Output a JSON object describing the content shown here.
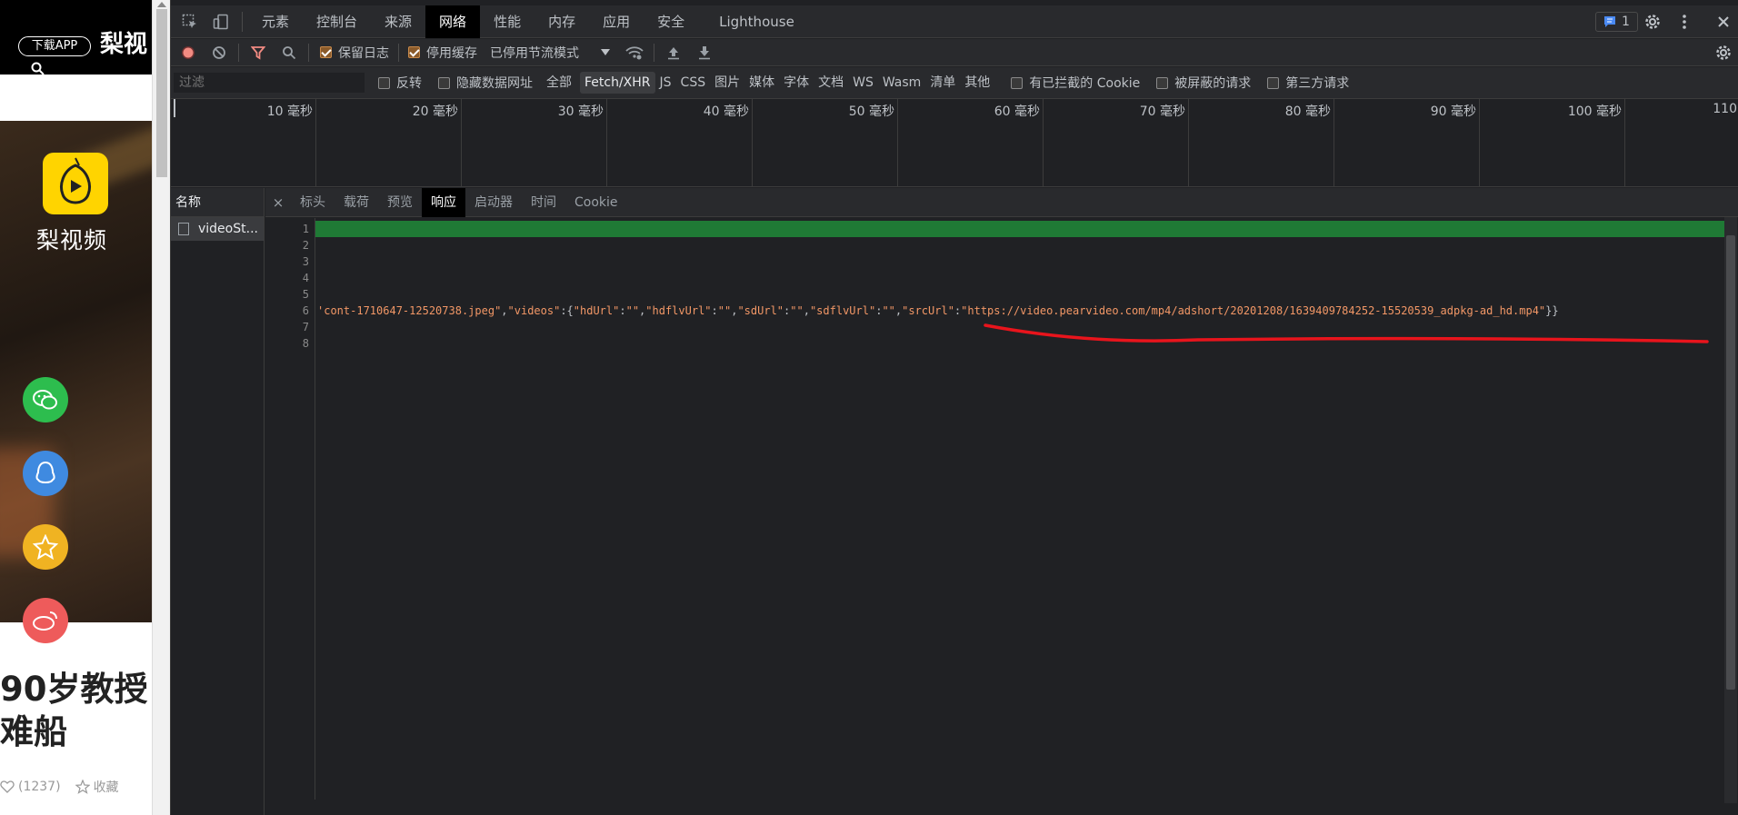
{
  "page": {
    "download_app": "下载APP",
    "brand_top": "梨视",
    "brand_hero": "梨视频",
    "title": "90岁教授\n难船",
    "likes": "(1237)",
    "favorite": "收藏",
    "colors": {
      "wechat": "#2dbd4e",
      "qq": "#3f8ae0",
      "qzone": "#f0b322",
      "weibo": "#ee5b5b",
      "logo": "#ffd400"
    }
  },
  "devtools": {
    "tabs": [
      "元素",
      "控制台",
      "来源",
      "网络",
      "性能",
      "内存",
      "应用",
      "安全",
      "Lighthouse"
    ],
    "active_tab": "网络",
    "issues_count": "1",
    "toolbar": {
      "preserve_log": "保留日志",
      "disable_cache": "停用缓存",
      "throttle": "已停用节流模式"
    },
    "filter": {
      "placeholder": "过滤",
      "invert": "反转",
      "hide_data_urls": "隐藏数据网址",
      "types": [
        "全部",
        "Fetch/XHR",
        "JS",
        "CSS",
        "图片",
        "媒体",
        "字体",
        "文档",
        "WS",
        "Wasm",
        "清单",
        "其他"
      ],
      "active_type": "Fetch/XHR",
      "blocked_cookies": "有已拦截的 Cookie",
      "blocked_requests": "被屏蔽的请求",
      "third_party": "第三方请求"
    },
    "timeline_ticks": [
      "10 毫秒",
      "20 毫秒",
      "30 毫秒",
      "40 毫秒",
      "50 毫秒",
      "60 毫秒",
      "70 毫秒",
      "80 毫秒",
      "90 毫秒",
      "100 毫秒",
      "110"
    ],
    "names_header": "名称",
    "requests": [
      "videoSt..."
    ],
    "detail_tabs": [
      "标头",
      "载荷",
      "预览",
      "响应",
      "启动器",
      "时间",
      "Cookie"
    ],
    "active_detail_tab": "响应",
    "line_numbers": [
      "1",
      "2",
      "3",
      "4",
      "5",
      "6",
      "7",
      "8"
    ],
    "line6": {
      "p1": "'cont-1710647-12520738.jpeg\"",
      "p2": ",",
      "p3": "\"videos\"",
      "p4": ":{",
      "p5": "\"hdUrl\"",
      "p6": ":",
      "p7": "\"\"",
      "p8": ",",
      "p9": "\"hdflvUrl\"",
      "p10": ":",
      "p11": "\"\"",
      "p12": ",",
      "p13": "\"sdUrl\"",
      "p14": ":",
      "p15": "\"\"",
      "p16": ",",
      "p17": "\"sdflvUrl\"",
      "p18": ":",
      "p19": "\"\"",
      "p20": ",",
      "p21": "\"srcUrl\"",
      "p22": ":",
      "p23": "\"https://video.pearvideo.com/mp4/adshort/20201208/1639409784252-15520539_adpkg-ad_hd.mp4\"",
      "p24": "}}"
    },
    "annotation_color": "#e8141c"
  }
}
